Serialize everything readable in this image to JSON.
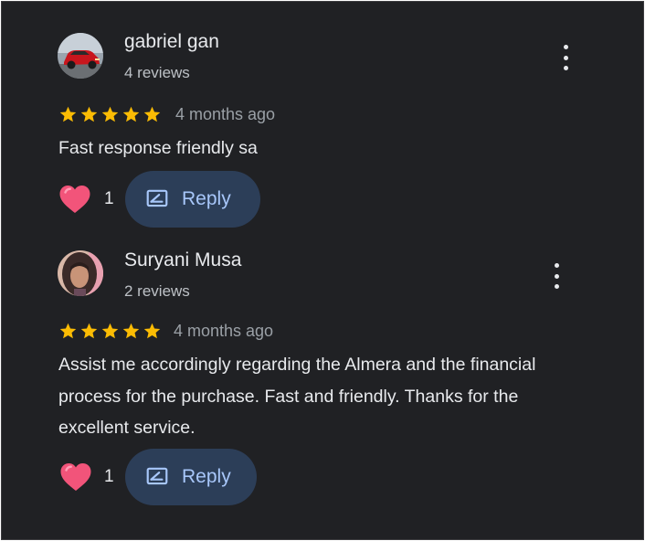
{
  "reviews": [
    {
      "author": "gabriel gan",
      "review_count": "4 reviews",
      "rating": 5,
      "age": "4 months ago",
      "text": "Fast response friendly sa",
      "likes": "1",
      "reply_label": "Reply",
      "avatar": "red-car-photo"
    },
    {
      "author": "Suryani Musa",
      "review_count": "2 reviews",
      "rating": 5,
      "age": "4 months ago",
      "text": "Assist me accordingly  regarding the Almera and the financial process for the purchase. Fast and friendly. Thanks for the excellent service.",
      "likes": "1",
      "reply_label": "Reply",
      "avatar": "person-photo"
    }
  ],
  "colors": {
    "background": "#202124",
    "star": "#fbbc04",
    "heart": "#f2547a",
    "reply_button_bg": "#2c3e58",
    "reply_text": "#a8c7fa"
  },
  "icons": [
    "more-vert-icon",
    "star-icon",
    "heart-icon",
    "reply-icon"
  ]
}
